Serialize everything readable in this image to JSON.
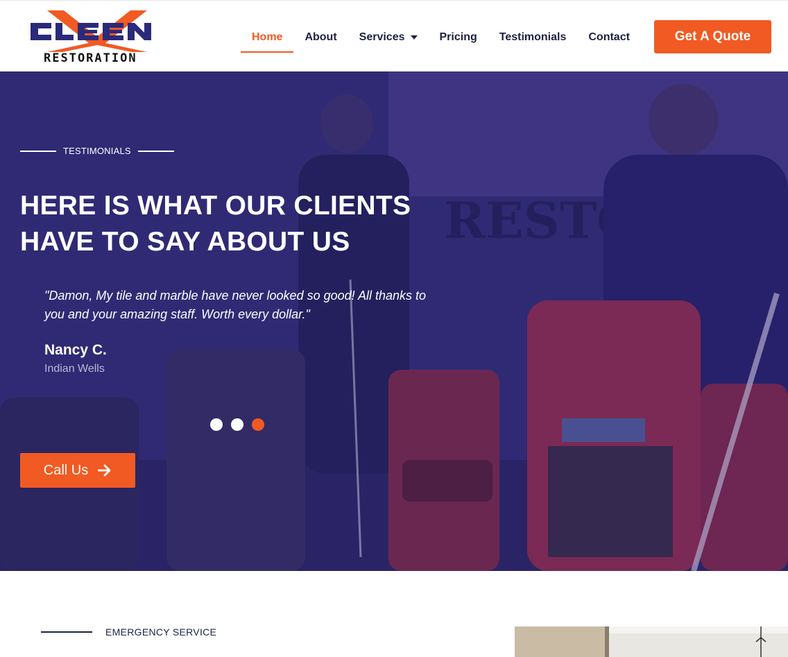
{
  "header": {
    "logo": {
      "wordmark": "CLEEN",
      "tagline": "RESTORATION",
      "alt": "Cleen Restoration logo"
    },
    "nav": [
      {
        "label": "Home",
        "active": true
      },
      {
        "label": "About",
        "active": false
      },
      {
        "label": "Services",
        "active": false,
        "has_dropdown": true
      },
      {
        "label": "Pricing",
        "active": false
      },
      {
        "label": "Testimonials",
        "active": false
      },
      {
        "label": "Contact",
        "active": false
      }
    ],
    "cta_label": "Get A Quote"
  },
  "hero": {
    "eyebrow": "TESTIMONIALS",
    "title_line1": "HERE IS WHAT OUR CLIENTS",
    "title_line2": "HAVE TO SAY ABOUT US",
    "testimonial": {
      "quote": "\"Damon, My tile and marble have never looked so good! All thanks to you and your amazing staff. Worth every dollar.\"",
      "author": "Nancy C.",
      "location": "Indian Wells"
    },
    "slider": {
      "count": 3,
      "active_index": 2
    },
    "call_label": "Call Us",
    "call_icon": "arrow-right-icon"
  },
  "section2": {
    "eyebrow": "EMERGENCY SERVICE"
  },
  "colors": {
    "accent": "#f15a22",
    "navy": "#1c2340",
    "hero_overlay": "#2e2870"
  }
}
